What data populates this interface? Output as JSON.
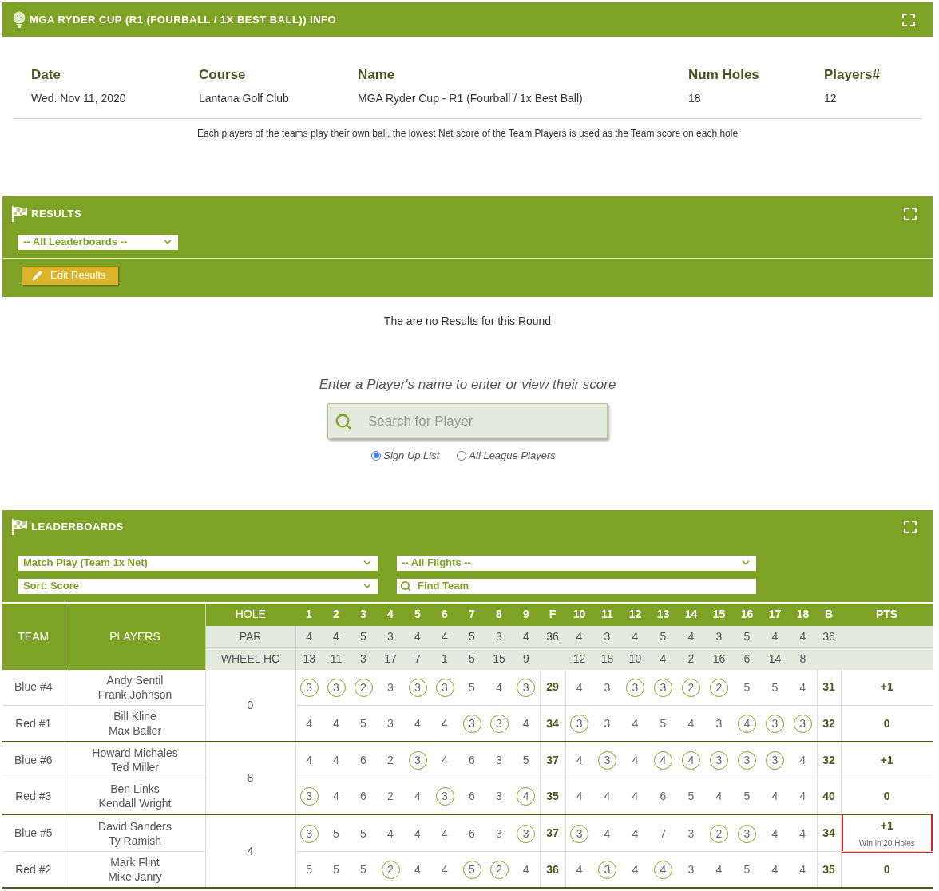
{
  "info": {
    "title": "MGA RYDER CUP (R1 (FOURBALL / 1X BEST BALL)) INFO",
    "fields": [
      {
        "label": "Date",
        "value": "Wed. Nov 11, 2020"
      },
      {
        "label": "Course",
        "value": "Lantana Golf Club"
      },
      {
        "label": "Name",
        "value": "MGA Ryder Cup - R1 (Fourball / 1x Best Ball)"
      },
      {
        "label": "Num Holes",
        "value": "18"
      },
      {
        "label": "Players#",
        "value": "12"
      }
    ],
    "description": "Each players of the teams play their own ball, the lowest Net score of the Team Players is used as the Team score on each hole"
  },
  "results": {
    "title": "RESULTS",
    "leaderboard_select": "-- All Leaderboards --",
    "edit_button": "Edit Results",
    "empty_message": "The are no Results for this Round"
  },
  "player_search": {
    "prompt": "Enter a Player's name to enter or view their score",
    "placeholder": "Search for Player",
    "options": [
      {
        "label": "Sign Up List",
        "selected": true
      },
      {
        "label": "All League Players",
        "selected": false
      }
    ]
  },
  "leaderboards": {
    "title": "LEADERBOARDS",
    "format_select": "Match Play (Team 1x Net)",
    "sort_select": "Sort: Score",
    "flight_select": "-- All Flights --",
    "find_placeholder": "Find Team",
    "table": {
      "headers": {
        "team": "TEAM",
        "players": "PLAYERS",
        "hole": "HOLE",
        "front": "F",
        "back": "B",
        "points": "PTS"
      },
      "holes_front": [
        "1",
        "2",
        "3",
        "4",
        "5",
        "6",
        "7",
        "8",
        "9"
      ],
      "holes_back": [
        "10",
        "11",
        "12",
        "13",
        "14",
        "15",
        "16",
        "17",
        "18"
      ],
      "par": {
        "label": "PAR",
        "front9": [
          "4",
          "4",
          "5",
          "3",
          "4",
          "4",
          "5",
          "3",
          "4"
        ],
        "out": "36",
        "back9": [
          "4",
          "3",
          "4",
          "5",
          "4",
          "3",
          "5",
          "4",
          "4"
        ],
        "in": "36"
      },
      "handicap": {
        "label": "WHEEL HC",
        "front9": [
          "13",
          "11",
          "3",
          "17",
          "7",
          "1",
          "5",
          "15",
          "9"
        ],
        "back9": [
          "12",
          "18",
          "10",
          "4",
          "2",
          "16",
          "6",
          "14",
          "8"
        ]
      },
      "matches": [
        {
          "handicap": "0",
          "teams": [
            {
              "team": "Blue #4",
              "players": [
                "Andy Sentil",
                "Frank Johnson"
              ],
              "front9": [
                {
                  "v": "3",
                  "circled": true
                },
                {
                  "v": "3",
                  "circled": true
                },
                {
                  "v": "2",
                  "circled": true
                },
                {
                  "v": "3",
                  "circled": false
                },
                {
                  "v": "3",
                  "circled": true
                },
                {
                  "v": "3",
                  "circled": true
                },
                {
                  "v": "5",
                  "circled": false
                },
                {
                  "v": "4",
                  "circled": false
                },
                {
                  "v": "3",
                  "circled": true
                }
              ],
              "out": "29",
              "back9": [
                {
                  "v": "4",
                  "circled": false
                },
                {
                  "v": "3",
                  "circled": false
                },
                {
                  "v": "3",
                  "circled": true
                },
                {
                  "v": "3",
                  "circled": true
                },
                {
                  "v": "2",
                  "circled": true
                },
                {
                  "v": "2",
                  "circled": true
                },
                {
                  "v": "5",
                  "circled": false
                },
                {
                  "v": "5",
                  "circled": false
                },
                {
                  "v": "4",
                  "circled": false
                }
              ],
              "in": "31",
              "pts": "+1",
              "highlighted": false
            },
            {
              "team": "Red #1",
              "players": [
                "Bill Kline",
                "Max Baller"
              ],
              "front9": [
                {
                  "v": "4",
                  "circled": false
                },
                {
                  "v": "4",
                  "circled": false
                },
                {
                  "v": "5",
                  "circled": false
                },
                {
                  "v": "3",
                  "circled": false
                },
                {
                  "v": "4",
                  "circled": false
                },
                {
                  "v": "4",
                  "circled": false
                },
                {
                  "v": "3",
                  "circled": true
                },
                {
                  "v": "3",
                  "circled": true
                },
                {
                  "v": "4",
                  "circled": false
                }
              ],
              "out": "34",
              "back9": [
                {
                  "v": "3",
                  "circled": true
                },
                {
                  "v": "3",
                  "circled": false
                },
                {
                  "v": "4",
                  "circled": false
                },
                {
                  "v": "5",
                  "circled": false
                },
                {
                  "v": "4",
                  "circled": false
                },
                {
                  "v": "3",
                  "circled": false
                },
                {
                  "v": "4",
                  "circled": true
                },
                {
                  "v": "3",
                  "circled": true
                },
                {
                  "v": "3",
                  "circled": true
                }
              ],
              "in": "32",
              "pts": "0",
              "highlighted": false
            }
          ]
        },
        {
          "handicap": "8",
          "teams": [
            {
              "team": "Blue #6",
              "players": [
                "Howard Michales",
                "Ted Miller"
              ],
              "front9": [
                {
                  "v": "4",
                  "circled": false
                },
                {
                  "v": "4",
                  "circled": false
                },
                {
                  "v": "6",
                  "circled": false
                },
                {
                  "v": "2",
                  "circled": false
                },
                {
                  "v": "3",
                  "circled": true
                },
                {
                  "v": "4",
                  "circled": false
                },
                {
                  "v": "6",
                  "circled": false
                },
                {
                  "v": "3",
                  "circled": false
                },
                {
                  "v": "5",
                  "circled": false
                }
              ],
              "out": "37",
              "back9": [
                {
                  "v": "4",
                  "circled": false
                },
                {
                  "v": "3",
                  "circled": true
                },
                {
                  "v": "4",
                  "circled": false
                },
                {
                  "v": "4",
                  "circled": true
                },
                {
                  "v": "4",
                  "circled": true
                },
                {
                  "v": "3",
                  "circled": true
                },
                {
                  "v": "3",
                  "circled": true
                },
                {
                  "v": "3",
                  "circled": true
                },
                {
                  "v": "4",
                  "circled": false
                }
              ],
              "in": "32",
              "pts": "+1",
              "highlighted": false
            },
            {
              "team": "Red #3",
              "players": [
                "Ben Links",
                "Kendall Wright"
              ],
              "front9": [
                {
                  "v": "3",
                  "circled": true
                },
                {
                  "v": "4",
                  "circled": false
                },
                {
                  "v": "6",
                  "circled": false
                },
                {
                  "v": "2",
                  "circled": false
                },
                {
                  "v": "4",
                  "circled": false
                },
                {
                  "v": "3",
                  "circled": true
                },
                {
                  "v": "6",
                  "circled": false
                },
                {
                  "v": "3",
                  "circled": false
                },
                {
                  "v": "4",
                  "circled": true
                }
              ],
              "out": "35",
              "back9": [
                {
                  "v": "4",
                  "circled": false
                },
                {
                  "v": "4",
                  "circled": false
                },
                {
                  "v": "4",
                  "circled": false
                },
                {
                  "v": "6",
                  "circled": false
                },
                {
                  "v": "5",
                  "circled": false
                },
                {
                  "v": "4",
                  "circled": false
                },
                {
                  "v": "5",
                  "circled": false
                },
                {
                  "v": "4",
                  "circled": false
                },
                {
                  "v": "4",
                  "circled": false
                }
              ],
              "in": "40",
              "pts": "0",
              "highlighted": false
            }
          ]
        },
        {
          "handicap": "4",
          "teams": [
            {
              "team": "Blue #5",
              "players": [
                "David Sanders",
                "Ty Ramish"
              ],
              "front9": [
                {
                  "v": "3",
                  "circled": true
                },
                {
                  "v": "5",
                  "circled": false
                },
                {
                  "v": "5",
                  "circled": false
                },
                {
                  "v": "4",
                  "circled": false
                },
                {
                  "v": "4",
                  "circled": false
                },
                {
                  "v": "4",
                  "circled": false
                },
                {
                  "v": "6",
                  "circled": false
                },
                {
                  "v": "3",
                  "circled": false
                },
                {
                  "v": "3",
                  "circled": true
                }
              ],
              "out": "37",
              "back9": [
                {
                  "v": "3",
                  "circled": true
                },
                {
                  "v": "4",
                  "circled": false
                },
                {
                  "v": "4",
                  "circled": false
                },
                {
                  "v": "7",
                  "circled": false
                },
                {
                  "v": "3",
                  "circled": false
                },
                {
                  "v": "2",
                  "circled": true
                },
                {
                  "v": "3",
                  "circled": true
                },
                {
                  "v": "4",
                  "circled": false
                },
                {
                  "v": "4",
                  "circled": false
                }
              ],
              "in": "34",
              "pts": "+1",
              "note": "Win in 20 Holes",
              "highlighted": true
            },
            {
              "team": "Red #2",
              "players": [
                "Mark Flint",
                "Mike Janry"
              ],
              "front9": [
                {
                  "v": "5",
                  "circled": false
                },
                {
                  "v": "5",
                  "circled": false
                },
                {
                  "v": "5",
                  "circled": false
                },
                {
                  "v": "2",
                  "circled": true
                },
                {
                  "v": "4",
                  "circled": false
                },
                {
                  "v": "4",
                  "circled": false
                },
                {
                  "v": "5",
                  "circled": true
                },
                {
                  "v": "2",
                  "circled": true
                },
                {
                  "v": "4",
                  "circled": false
                }
              ],
              "out": "36",
              "back9": [
                {
                  "v": "4",
                  "circled": false
                },
                {
                  "v": "3",
                  "circled": true
                },
                {
                  "v": "4",
                  "circled": false
                },
                {
                  "v": "4",
                  "circled": true
                },
                {
                  "v": "3",
                  "circled": false
                },
                {
                  "v": "4",
                  "circled": false
                },
                {
                  "v": "5",
                  "circled": false
                },
                {
                  "v": "4",
                  "circled": false
                },
                {
                  "v": "4",
                  "circled": false
                }
              ],
              "in": "35",
              "pts": "0",
              "highlighted": false
            }
          ]
        }
      ]
    }
  }
}
